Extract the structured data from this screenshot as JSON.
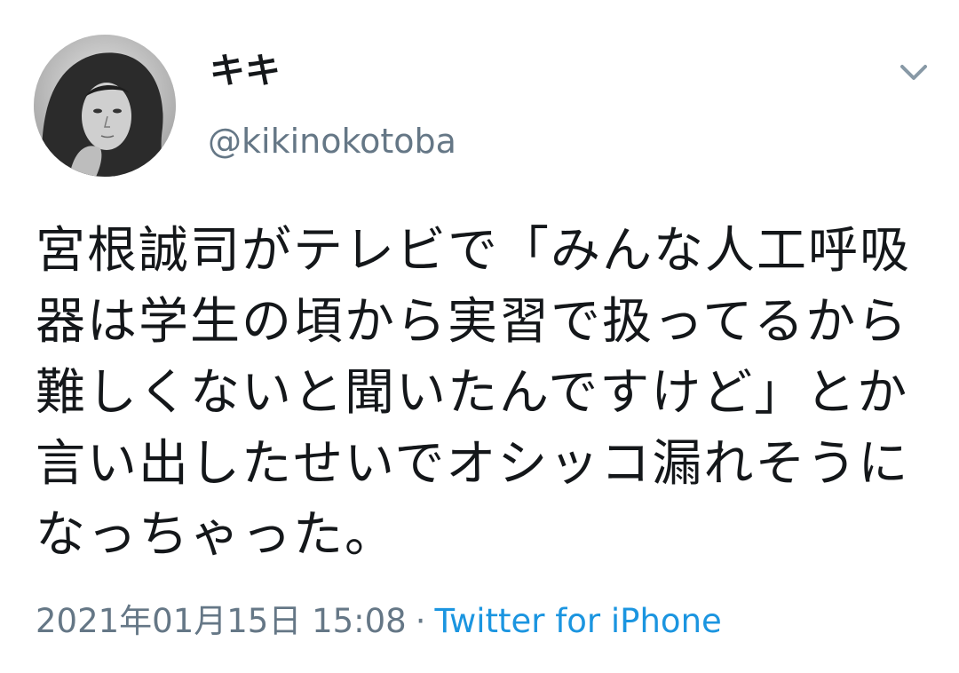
{
  "user": {
    "display_name": "キキ",
    "handle": "@kikinokotoba"
  },
  "tweet": {
    "text": "宮根誠司がテレビで「みんな人工呼吸器は学生の頃から実習で扱ってるから難しくないと聞いたんですけど」とか言い出したせいでオシッコ漏れそうになっちゃった。",
    "timestamp": "2021年01月15日 15:08",
    "separator": "·",
    "source": "Twitter for iPhone"
  },
  "icons": {
    "menu": "chevron-down-icon"
  },
  "colors": {
    "text": "#14171a",
    "secondary": "#657786",
    "link": "#1b95e0",
    "background": "#ffffff"
  }
}
